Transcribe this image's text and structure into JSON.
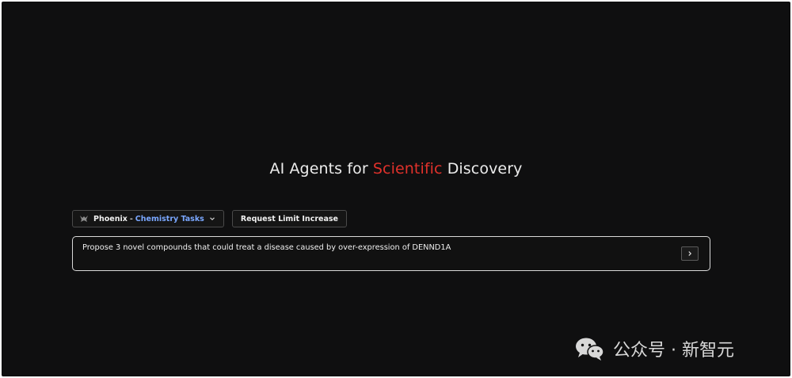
{
  "headline": {
    "prefix": "AI Agents for ",
    "accent_word": "Scientific",
    "suffix": " Discovery",
    "accent_color": "#e0312b"
  },
  "controls": {
    "agent_selector": {
      "icon": "phoenix-icon",
      "name": "Phoenix",
      "separator": "-",
      "mode": "Chemistry Tasks",
      "mode_color": "#7aa7ff",
      "dropdown_icon": "chevron-down-icon"
    },
    "request_limit_button": "Request Limit Increase"
  },
  "prompt": {
    "value": "Propose 3 novel compounds that could treat a disease caused by over-expression of DENND1A",
    "send_icon": "chevron-right-icon"
  },
  "watermark": {
    "icon": "wechat-icon",
    "text": "公众号 · 新智元"
  }
}
